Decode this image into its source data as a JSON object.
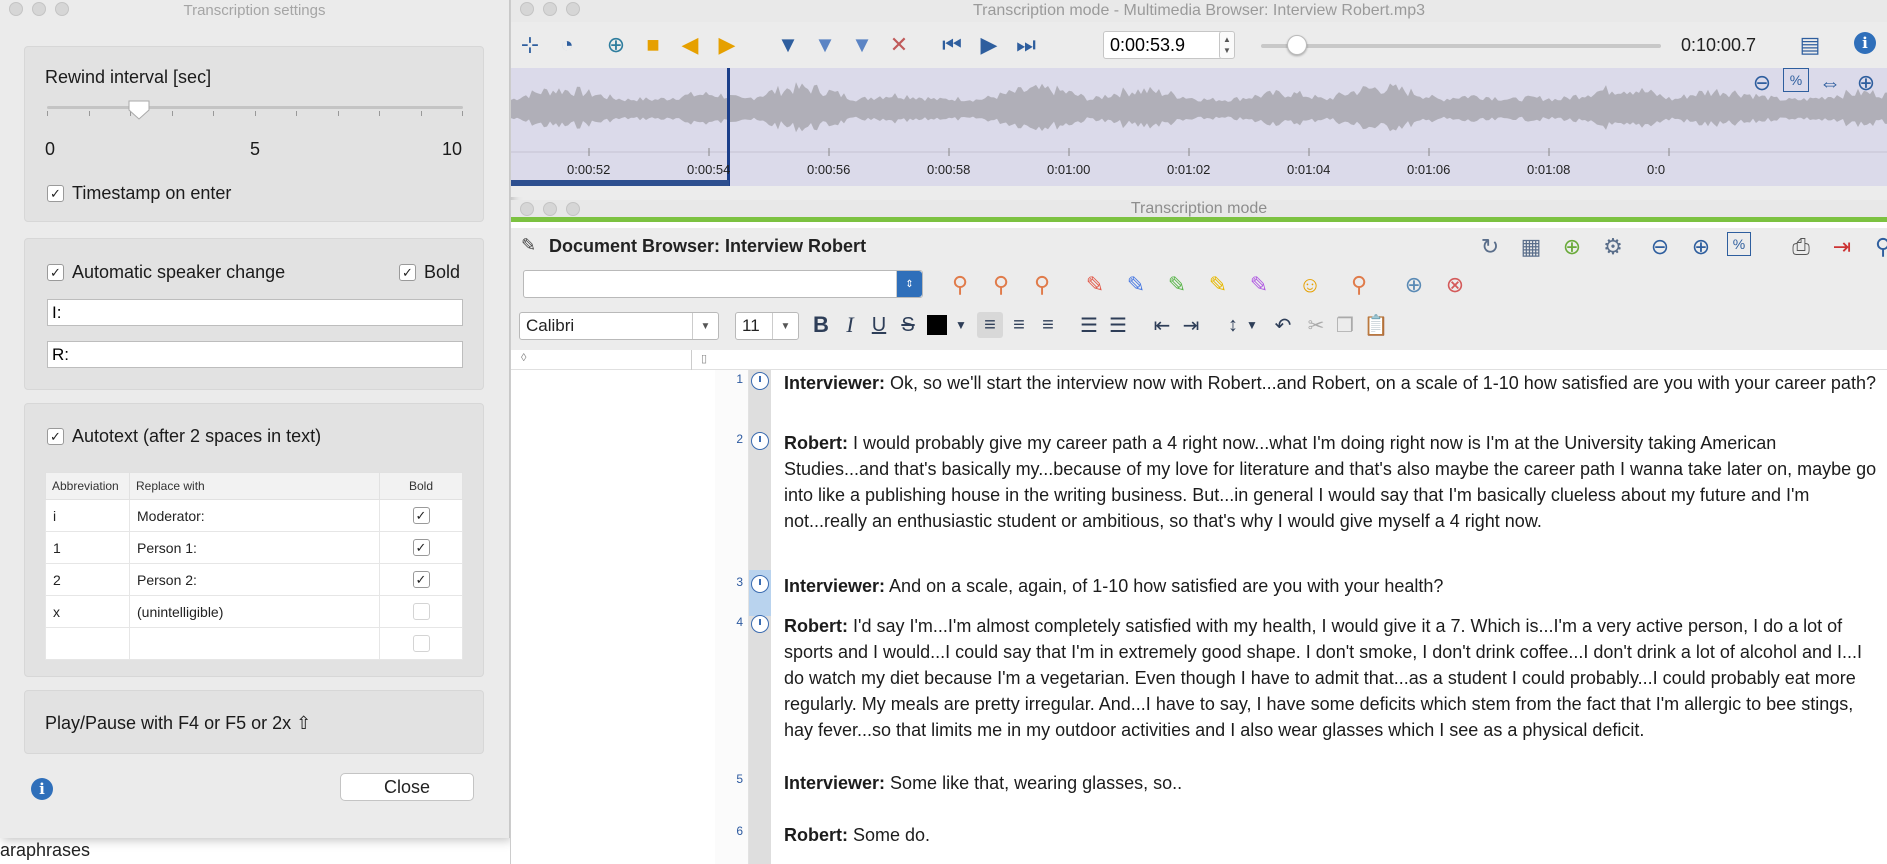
{
  "background": {
    "partial_text": "araphrases"
  },
  "settings": {
    "title": "Transcription settings",
    "rewind": {
      "label": "Rewind interval [sec]",
      "min": "0",
      "mid": "5",
      "max": "10",
      "value_fraction": 0.22
    },
    "timestamp_on_enter": {
      "label": "Timestamp on enter",
      "checked": true
    },
    "speaker": {
      "label": "Automatic speaker change",
      "bold_label": "Bold",
      "field1": "I:",
      "field2": "R:"
    },
    "autotext": {
      "label": "Autotext (after 2 spaces in text)",
      "headers": [
        "Abbreviation",
        "Replace with",
        "Bold"
      ],
      "rows": [
        {
          "abbr": "i",
          "replace": "Moderator:",
          "bold": true
        },
        {
          "abbr": "1",
          "replace": "Person 1:",
          "bold": true
        },
        {
          "abbr": "2",
          "replace": "Person 2:",
          "bold": true
        },
        {
          "abbr": "x",
          "replace": "(unintelligible)",
          "bold": false
        },
        {
          "abbr": "",
          "replace": "",
          "bold": false
        }
      ]
    },
    "play_pause_hint": "Play/Pause with F4 or F5 or 2x ⇧",
    "close_label": "Close"
  },
  "media": {
    "title": "Transcription mode - Multimedia Browser:  Interview Robert.mp3",
    "current_time": "0:00:53.9",
    "total_time": "0:10:00.7",
    "position_fraction": 0.09,
    "ticks": [
      "0:00:52",
      "0:00:54",
      "0:00:56",
      "0:00:58",
      "0:01:00",
      "0:01:02",
      "0:01:04",
      "0:01:06",
      "0:01:08",
      "0:0"
    ]
  },
  "transcription": {
    "title": "Transcription mode",
    "doc_title": "Document Browser: Interview Robert",
    "font": "Calibri",
    "size": "11",
    "paragraphs": [
      {
        "num": "1",
        "speaker": "Interviewer:",
        "text": " Ok, so we'll start the interview now with Robert...and Robert, on a scale of 1-10 how satisfied are you with your career path?"
      },
      {
        "num": "2",
        "speaker": "Robert:",
        "text": " I would probably give my career path a 4 right now...what I'm doing right now is I'm at the University taking American Studies...and that's basically my...because of my love for literature and that's also maybe the career path I wanna take later on, maybe go into like a publishing house in the writing business. But...in general I would say that I'm basically clueless about my future and I'm not...really an enthusiastic student or ambitious, so that's why I would give myself a 4 right now."
      },
      {
        "num": "3",
        "speaker": "Interviewer:",
        "text": " And on a scale, again, of 1-10 how satisfied are you with your health?"
      },
      {
        "num": "4",
        "speaker": "Robert:",
        "text": " I'd say I'm...I'm almost completely satisfied  with my health, I would give it a 7. Which is...I'm a very active person, I do a lot of sports and I would...I could say that I'm in extremely good shape. I don't smoke, I don't drink coffee...I don't drink a lot of alcohol and I...I do watch my diet because I'm a vegetarian. Even though I have to admit that...as a student I could probably...I could probably eat more regularly. My meals are pretty irregular. And...I have to say, I have some deficits which stem from the fact that I'm allergic to bee stings, hay fever...so that limits me in my outdoor activities and I also wear glasses which I see as a physical deficit."
      },
      {
        "num": "5",
        "speaker": "Interviewer:",
        "text": " Some like that, wearing glasses, so.."
      },
      {
        "num": "6",
        "speaker": "Robert:",
        "text": " Some do."
      }
    ]
  },
  "colors": {
    "accent": "#2f6fba",
    "green_bar": "#7cc241",
    "wave_bg": "#dbdaea",
    "wave_fg": "#b0afb8",
    "playhead": "#1c3f8a"
  }
}
